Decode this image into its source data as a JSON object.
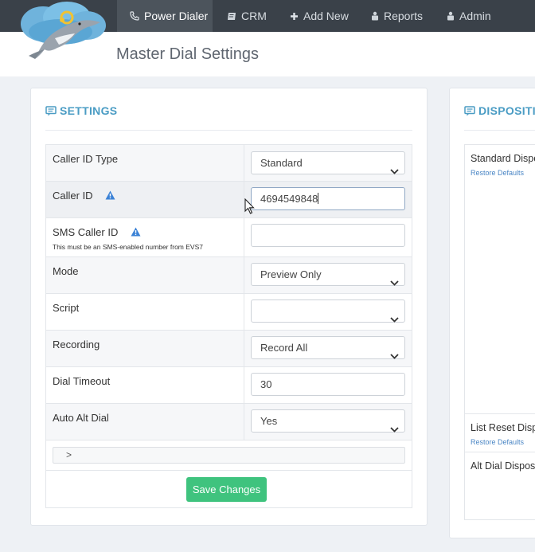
{
  "nav": {
    "items": [
      {
        "label": "Power Dialer",
        "icon": "phone-icon",
        "active": true
      },
      {
        "label": "CRM",
        "icon": "book-icon"
      },
      {
        "label": "Add New",
        "icon": "plus-icon"
      },
      {
        "label": "Reports",
        "icon": "tag-icon"
      },
      {
        "label": "Admin",
        "icon": "admin-icon"
      }
    ]
  },
  "header": {
    "title": "Master Dial Settings",
    "logo": "dolphin-logo"
  },
  "settings": {
    "title": "SETTINGS",
    "rows": {
      "caller_id_type": {
        "label": "Caller ID Type",
        "value": "Standard"
      },
      "caller_id": {
        "label": "Caller ID",
        "value": "4694549848"
      },
      "sms_caller_id": {
        "label": "SMS Caller ID",
        "note": "This must be an SMS-enabled number from EVS7",
        "value": ""
      },
      "mode": {
        "label": "Mode",
        "value": "Preview Only"
      },
      "script": {
        "label": "Script",
        "value": ""
      },
      "recording": {
        "label": "Recording",
        "value": "Record All"
      },
      "dial_timeout": {
        "label": "Dial Timeout",
        "value": "30"
      },
      "auto_alt_dial": {
        "label": "Auto Alt Dial",
        "value": "Yes"
      }
    },
    "expand_symbol": ">",
    "save_label": "Save Changes"
  },
  "dispositions": {
    "title": "DISPOSITIO",
    "standard_label": "Standard Dispo",
    "list_reset_label": "List Reset Disp",
    "alt_dial_label": "Alt Dial Dispos",
    "restore_label": "Restore Defaults"
  },
  "colors": {
    "nav_bg": "#3a4149",
    "accent": "#4a9cc4",
    "save_button": "#3fc37e",
    "info_icon": "#3b82d6",
    "link": "#4a86c5"
  }
}
